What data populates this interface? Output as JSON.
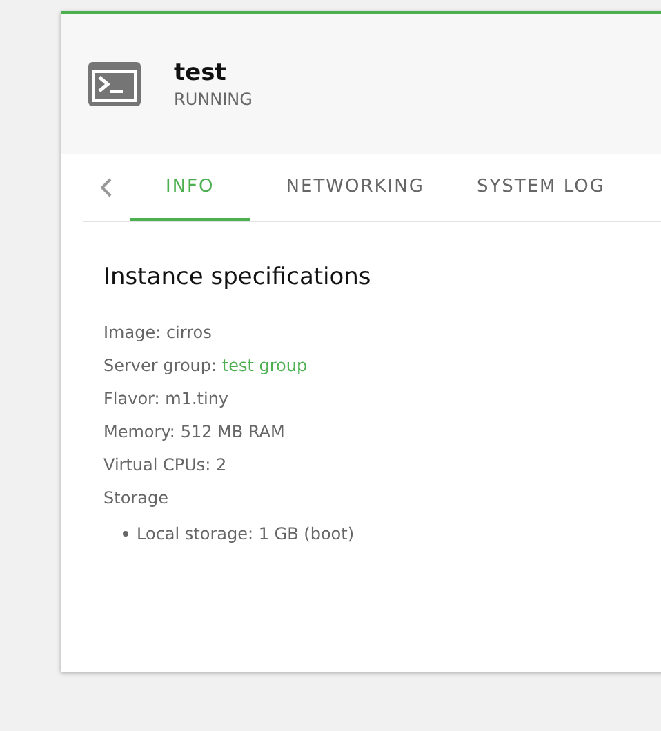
{
  "instance": {
    "name": "test",
    "status": "RUNNING"
  },
  "tabs": [
    {
      "label": "INFO",
      "selected": true
    },
    {
      "label": "NETWORKING",
      "selected": false
    },
    {
      "label": "SYSTEM LOG",
      "selected": false
    }
  ],
  "section_title": "Instance specifications",
  "specs": [
    {
      "label": "Image:",
      "value": "cirros",
      "kind": "text"
    },
    {
      "label": "Server group:",
      "value": "test group",
      "kind": "link"
    },
    {
      "label": "Flavor:",
      "value": "m1.tiny",
      "kind": "text"
    },
    {
      "label": "Memory:",
      "value": "512 MB RAM",
      "kind": "text"
    },
    {
      "label": "Virtual CPUs:",
      "value": "2",
      "kind": "text"
    },
    {
      "label": "Storage",
      "kind": "heading"
    }
  ],
  "storage_items": [
    "Local storage: 1 GB (boot)"
  ]
}
